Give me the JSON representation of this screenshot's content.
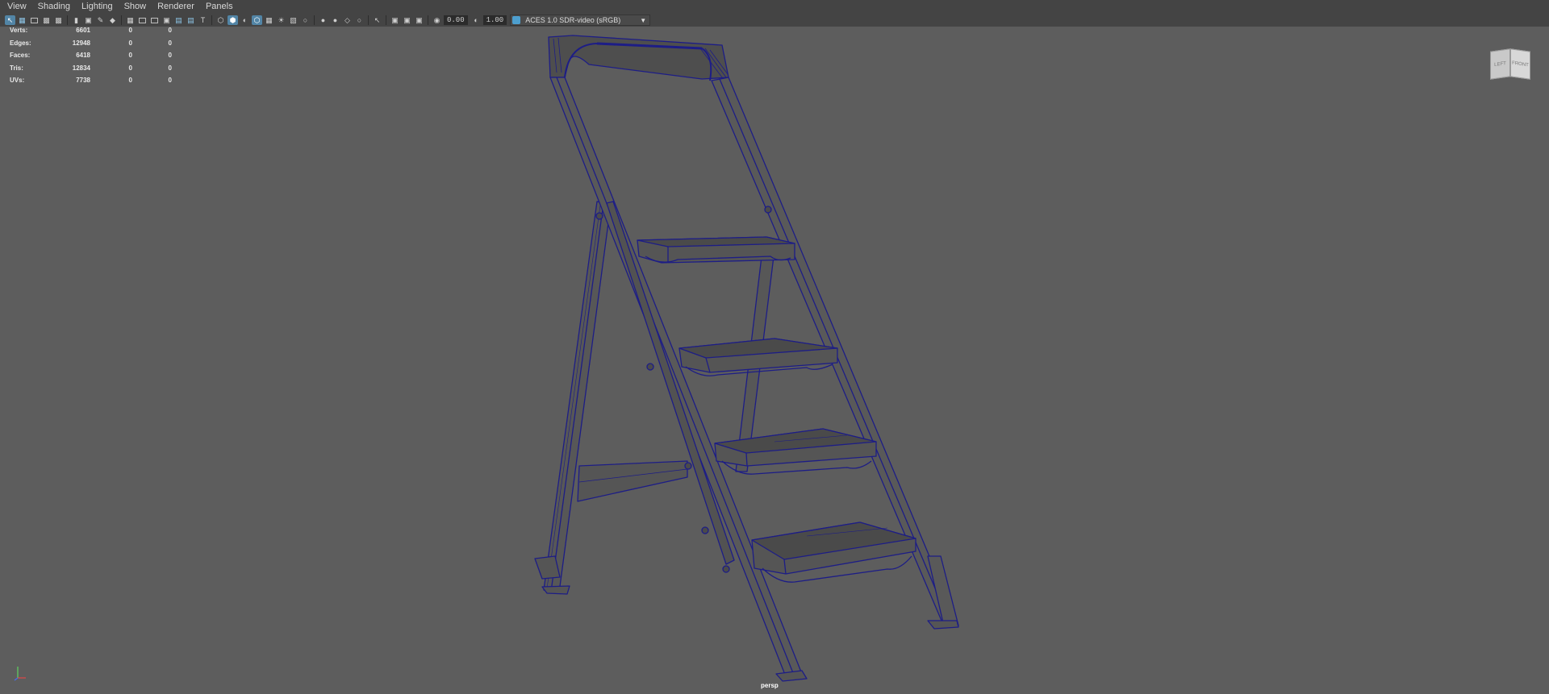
{
  "menu": [
    "View",
    "Shading",
    "Lighting",
    "Show",
    "Renderer",
    "Panels"
  ],
  "toolbar": {
    "exposure": "0.00",
    "gamma": "1.00",
    "color_space": "ACES 1.0 SDR-video (sRGB)"
  },
  "hud": {
    "rows": [
      {
        "label": "Verts:",
        "v1": "6601",
        "v2": "0",
        "v3": "0"
      },
      {
        "label": "Edges:",
        "v1": "12948",
        "v2": "0",
        "v3": "0"
      },
      {
        "label": "Faces:",
        "v1": "6418",
        "v2": "0",
        "v3": "0"
      },
      {
        "label": "Tris:",
        "v1": "12834",
        "v2": "0",
        "v3": "0"
      },
      {
        "label": "UVs:",
        "v1": "7738",
        "v2": "0",
        "v3": "0"
      }
    ]
  },
  "viewcube": {
    "left": "LEFT",
    "front": "FRONT"
  },
  "camera_label": "persp",
  "colors": {
    "viewport_bg": "#5d5d5d",
    "wireframe": "#1d1d86",
    "mesh_fill": "#5a5a5a",
    "accent": "#5285a6"
  }
}
